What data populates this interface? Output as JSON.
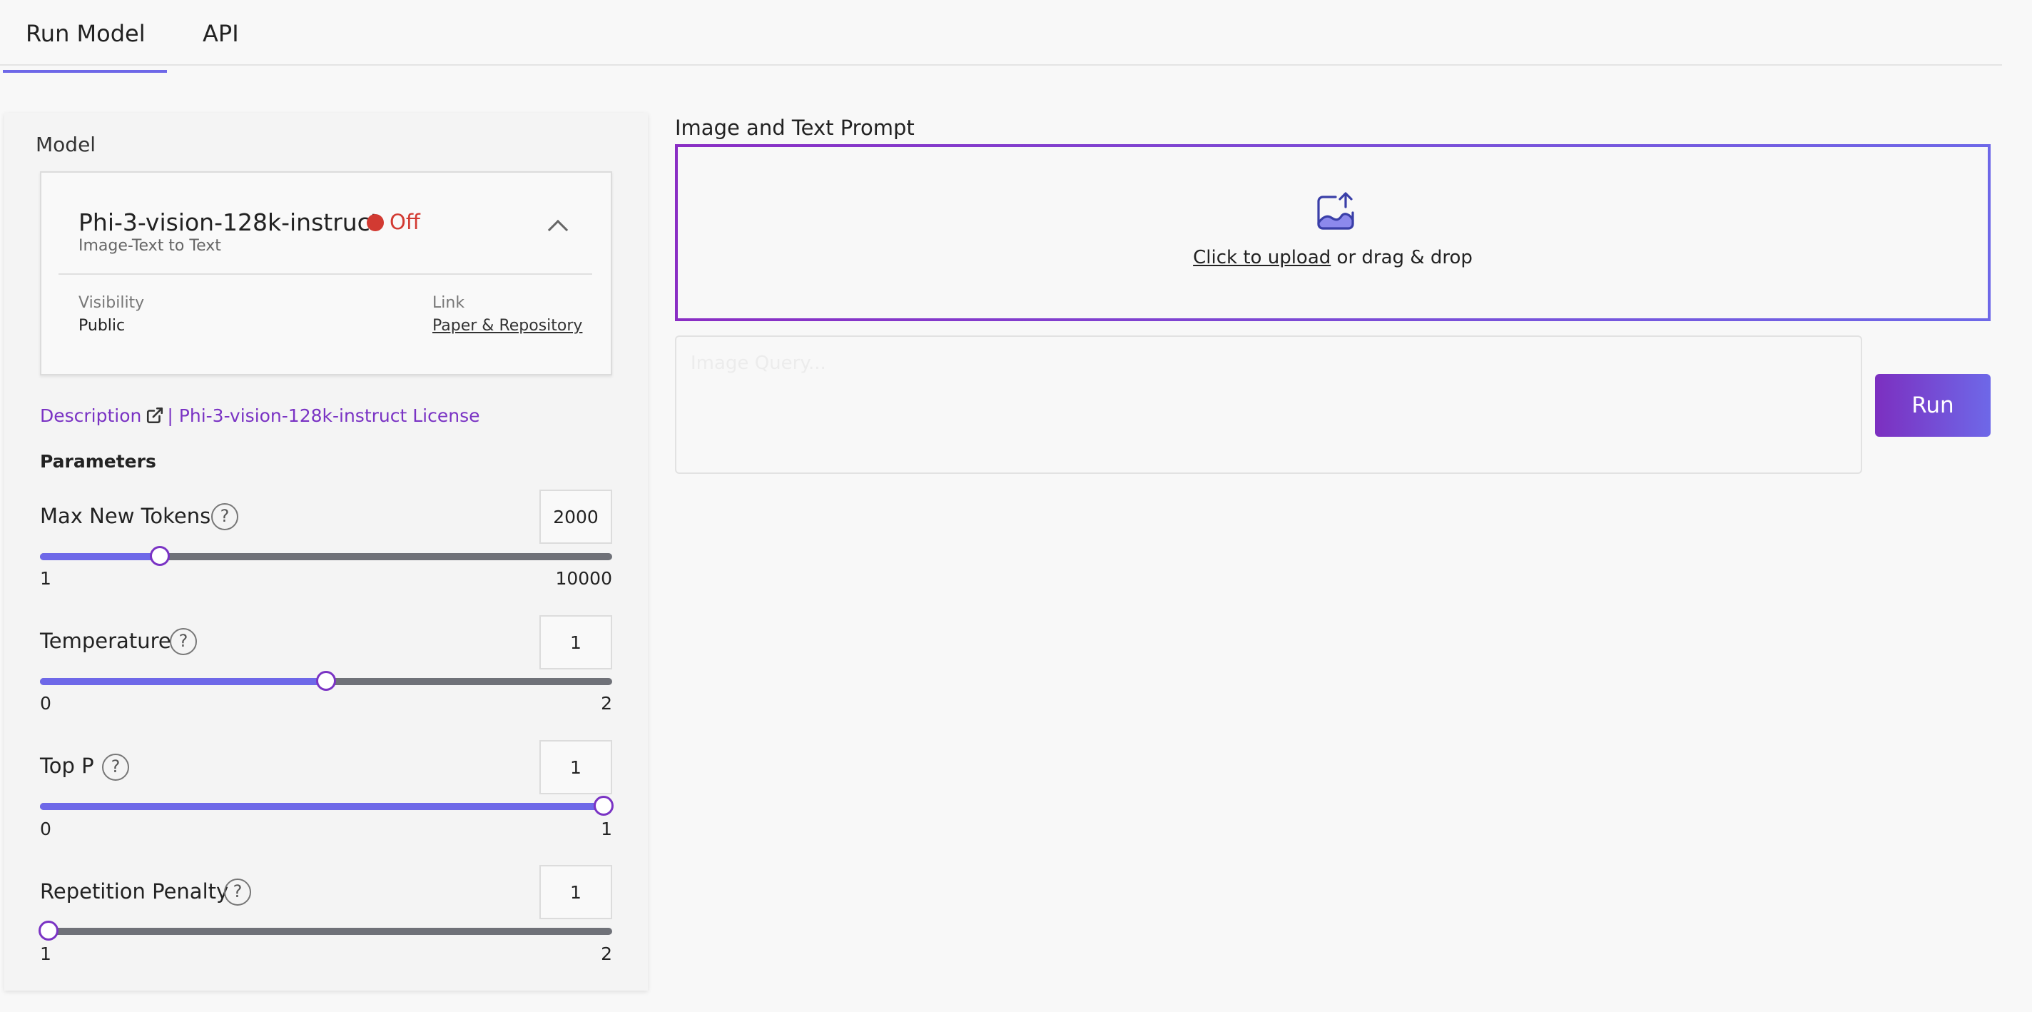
{
  "tabs": [
    {
      "label": "Run Model",
      "active": true
    },
    {
      "label": "API",
      "active": false
    }
  ],
  "model_section": {
    "label": "Model",
    "name": "Phi-3-vision-128k-instruct",
    "status": "Off",
    "status_color": "#d23a32",
    "type": "Image-Text to Text",
    "visibility_label": "Visibility",
    "visibility_value": "Public",
    "link_label": "Link",
    "link_text": "Paper & Repository"
  },
  "description": {
    "link_text": "Description",
    "separator": "|",
    "license_text": "Phi-3-vision-128k-instruct License"
  },
  "parameters": {
    "heading": "Parameters",
    "items": [
      {
        "label": "Max New Tokens",
        "value": "2000",
        "min": "1",
        "max": "10000",
        "fraction": 0.2
      },
      {
        "label": "Temperature",
        "value": "1",
        "min": "0",
        "max": "2",
        "fraction": 0.5
      },
      {
        "label": "Top P",
        "value": "1",
        "min": "0",
        "max": "1",
        "fraction": 1.0
      },
      {
        "label": "Repetition Penalty",
        "value": "1",
        "min": "1",
        "max": "2",
        "fraction": 0.0
      }
    ]
  },
  "prompt": {
    "label": "Image and Text Prompt",
    "upload_link": "Click to upload",
    "upload_suffix": " or drag & drop",
    "query_placeholder": "Image Query..."
  },
  "run_button": {
    "label": "Run"
  },
  "colors": {
    "accent": "#6e68e8",
    "purple": "#7a33c4",
    "status_off": "#d23a32"
  },
  "icons": [
    "external-link-icon",
    "help-icon",
    "upload-image-icon",
    "chevron-up-icon"
  ]
}
